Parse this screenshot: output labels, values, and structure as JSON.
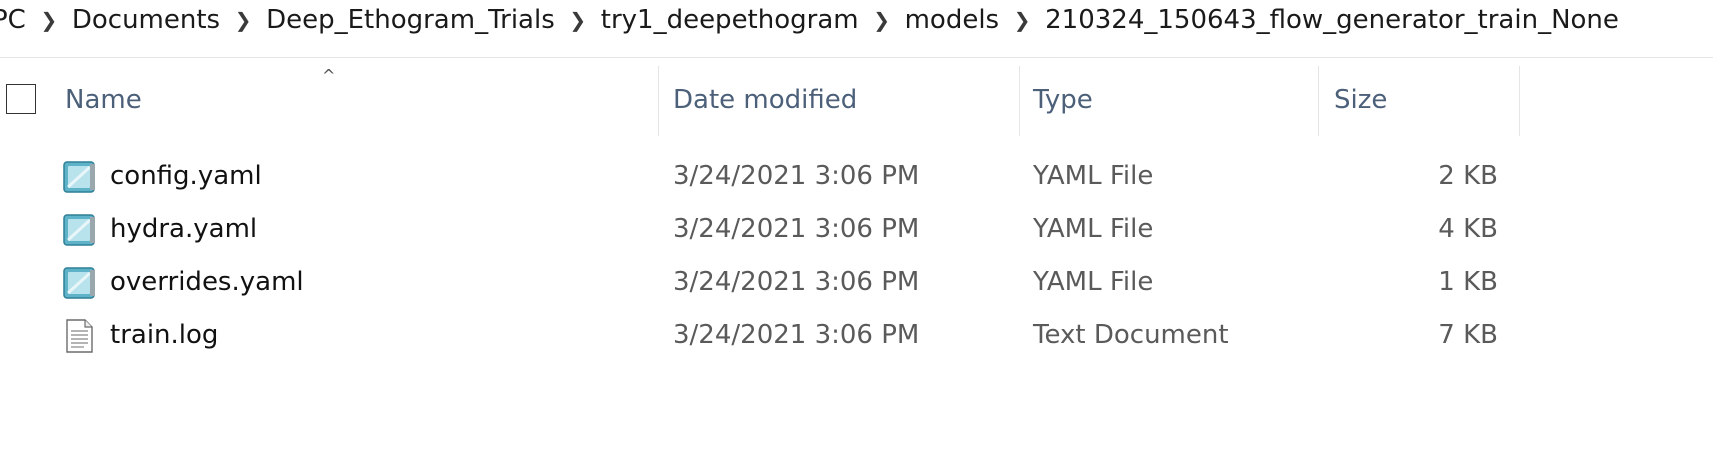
{
  "breadcrumb": {
    "items": [
      {
        "label": "PC"
      },
      {
        "label": "Documents"
      },
      {
        "label": "Deep_Ethogram_Trials"
      },
      {
        "label": "try1_deepethogram"
      },
      {
        "label": "models"
      },
      {
        "label": "210324_150643_flow_generator_train_None"
      }
    ],
    "separator": "❯"
  },
  "columns": {
    "name": "Name",
    "date_modified": "Date modified",
    "type": "Type",
    "size": "Size",
    "sort_indicator": "^"
  },
  "files": [
    {
      "name": "config.yaml",
      "date": "3/24/2021 3:06 PM",
      "type": "YAML File",
      "size": "2 KB",
      "icon": "yaml-file-icon"
    },
    {
      "name": "hydra.yaml",
      "date": "3/24/2021 3:06 PM",
      "type": "YAML File",
      "size": "4 KB",
      "icon": "yaml-file-icon"
    },
    {
      "name": "overrides.yaml",
      "date": "3/24/2021 3:06 PM",
      "type": "YAML File",
      "size": "1 KB",
      "icon": "yaml-file-icon"
    },
    {
      "name": "train.log",
      "date": "3/24/2021 3:06 PM",
      "type": "Text Document",
      "size": "7 KB",
      "icon": "text-document-icon"
    }
  ],
  "colors": {
    "header_text": "#4c607a",
    "secondary_text": "#5a5a5a"
  }
}
